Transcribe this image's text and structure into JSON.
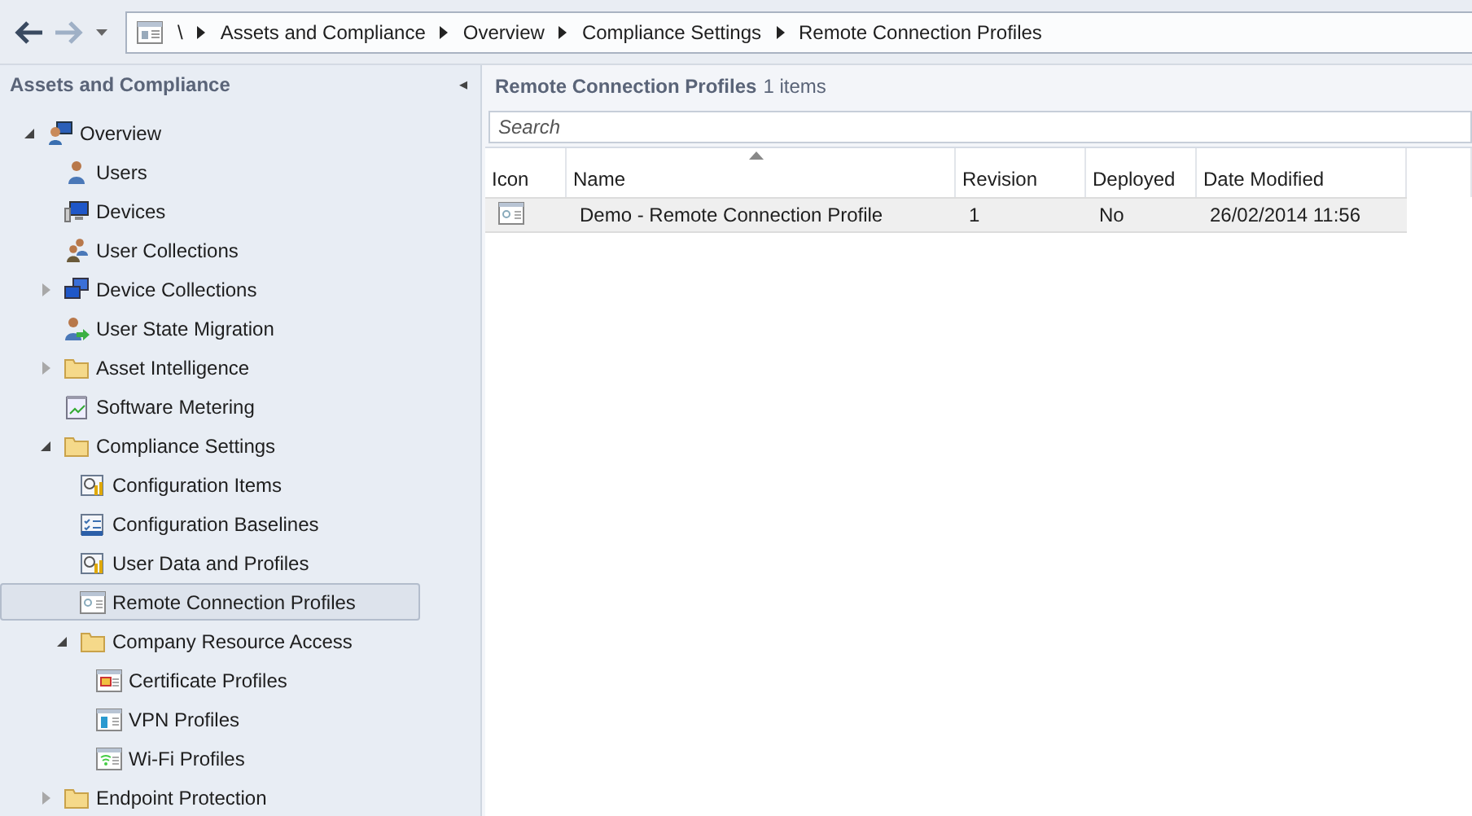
{
  "breadcrumb": {
    "separator": "\\",
    "items": [
      "Assets and Compliance",
      "Overview",
      "Compliance Settings",
      "Remote Connection Profiles"
    ]
  },
  "navigation": {
    "title": "Assets and Compliance",
    "collapse_glyph": "◂",
    "tree": [
      {
        "label": "Overview",
        "kind": "overview",
        "expanded": true,
        "selected": false,
        "children": [
          {
            "label": "Users",
            "kind": "person",
            "selected": false
          },
          {
            "label": "Devices",
            "kind": "computer",
            "selected": false
          },
          {
            "label": "User Collections",
            "kind": "people",
            "selected": false
          },
          {
            "label": "Device Collections",
            "kind": "computers",
            "expanded": false,
            "selected": false
          },
          {
            "label": "User State Migration",
            "kind": "migration",
            "selected": false
          },
          {
            "label": "Asset Intelligence",
            "kind": "folder",
            "expanded": false,
            "selected": false
          },
          {
            "label": "Software Metering",
            "kind": "report",
            "selected": false
          },
          {
            "label": "Compliance Settings",
            "kind": "folder",
            "expanded": true,
            "selected": false,
            "children": [
              {
                "label": "Configuration Items",
                "kind": "config",
                "selected": false
              },
              {
                "label": "Configuration Baselines",
                "kind": "baseline",
                "selected": false
              },
              {
                "label": "User Data and Profiles",
                "kind": "config",
                "selected": false
              },
              {
                "label": "Remote Connection Profiles",
                "kind": "profile",
                "selected": true
              },
              {
                "label": "Company Resource Access",
                "kind": "folder",
                "expanded": true,
                "selected": false,
                "children": [
                  {
                    "label": "Certificate Profiles",
                    "kind": "certificate",
                    "selected": false
                  },
                  {
                    "label": "VPN Profiles",
                    "kind": "vpn",
                    "selected": false
                  },
                  {
                    "label": "Wi-Fi Profiles",
                    "kind": "wifi",
                    "selected": false
                  }
                ]
              }
            ]
          },
          {
            "label": "Endpoint Protection",
            "kind": "folder",
            "expanded": false,
            "selected": false
          }
        ]
      }
    ]
  },
  "list": {
    "title": "Remote Connection Profiles",
    "count": "1 items",
    "search": {
      "placeholder": "Search"
    },
    "columns": [
      "Icon",
      "Name",
      "Revision",
      "Deployed",
      "Date Modified"
    ],
    "rows": [
      {
        "name": "Demo - Remote Connection Profile",
        "revision": "1",
        "deployed": "No",
        "date_modified": "26/02/2014 11:56",
        "selected": true
      }
    ]
  }
}
